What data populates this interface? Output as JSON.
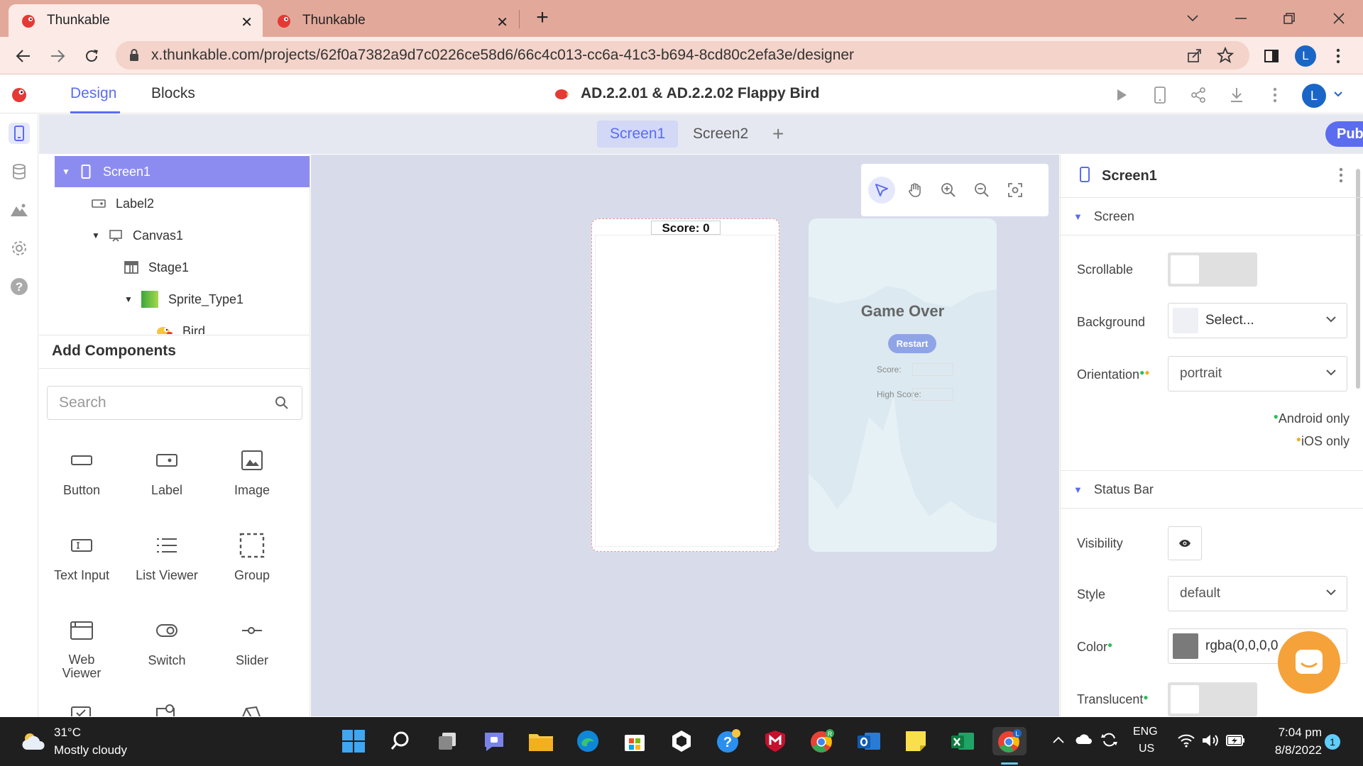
{
  "browser": {
    "tabs": [
      {
        "title": "Thunkable",
        "active": true
      },
      {
        "title": "Thunkable",
        "active": false
      }
    ],
    "url": "x.thunkable.com/projects/62f0a7382a9d7c0226ce58d6/66c4c013-cc6a-41c3-b694-8cd80c2efa3e/designer",
    "profile_initial": "L"
  },
  "app": {
    "tabs": {
      "design": "Design",
      "blocks": "Blocks"
    },
    "project_title": "AD.2.2.01 & AD.2.2.02 Flappy Bird",
    "user_initial": "L",
    "accent_color": "#5b6cf0"
  },
  "screens": {
    "tabs": [
      "Screen1",
      "Screen2"
    ],
    "add_label": "+",
    "public_label": "Public"
  },
  "tree": [
    {
      "label": "Screen1",
      "icon": "phone-icon",
      "selected": true
    },
    {
      "label": "Label2",
      "icon": "label-icon"
    },
    {
      "label": "Canvas1",
      "icon": "canvas-icon"
    },
    {
      "label": "Stage1",
      "icon": "stage-icon"
    },
    {
      "label": "Sprite_Type1",
      "icon": "sprite-icon"
    },
    {
      "label": "Bird",
      "icon": "bird-icon"
    }
  ],
  "add_components": {
    "title": "Add Components",
    "search_placeholder": "Search",
    "items": [
      "Button",
      "Label",
      "Image",
      "Text Input",
      "List Viewer",
      "Group",
      "Web Viewer",
      "Switch",
      "Slider"
    ]
  },
  "canvas": {
    "screen1_score": "Score: 0",
    "screen2": {
      "title": "Game Over",
      "restart": "Restart",
      "score_label": "Score:",
      "high_score_label": "High Score:"
    }
  },
  "properties": {
    "title": "Screen1",
    "screen_section": "Screen",
    "scrollable_label": "Scrollable",
    "background_label": "Background",
    "background_value": "Select...",
    "orientation_label": "Orientation",
    "orientation_value": "portrait",
    "android_only": "Android only",
    "ios_only": "iOS only",
    "status_bar_section": "Status Bar",
    "visibility_label": "Visibility",
    "style_label": "Style",
    "style_value": "default",
    "color_label": "Color",
    "color_value": "rgba(0,0,0,0",
    "translucent_label": "Translucent"
  },
  "taskbar": {
    "weather_temp": "31°C",
    "weather_desc": "Mostly cloudy",
    "lang_top": "ENG",
    "lang_bottom": "US",
    "time": "7:04 pm",
    "date": "8/8/2022",
    "notification_count": "1"
  }
}
